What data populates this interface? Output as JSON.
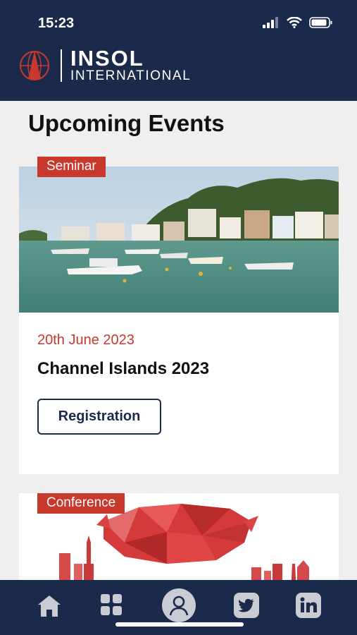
{
  "status_bar": {
    "time": "15:23"
  },
  "header": {
    "logo_line1": "INSOL",
    "logo_line2": "INTERNATIONAL"
  },
  "page": {
    "title": "Upcoming Events"
  },
  "events": [
    {
      "tag": "Seminar",
      "date": "20th June 2023",
      "title": "Channel Islands 2023",
      "button_label": "Registration"
    },
    {
      "tag": "Conference"
    }
  ],
  "tabbar": {
    "items": [
      {
        "icon": "home-icon"
      },
      {
        "icon": "grid-icon"
      },
      {
        "icon": "profile-icon"
      },
      {
        "icon": "twitter-icon"
      },
      {
        "icon": "linkedin-icon"
      }
    ]
  },
  "colors": {
    "navy": "#1b2a4a",
    "accent_red": "#c8382d",
    "background": "#efefef"
  }
}
